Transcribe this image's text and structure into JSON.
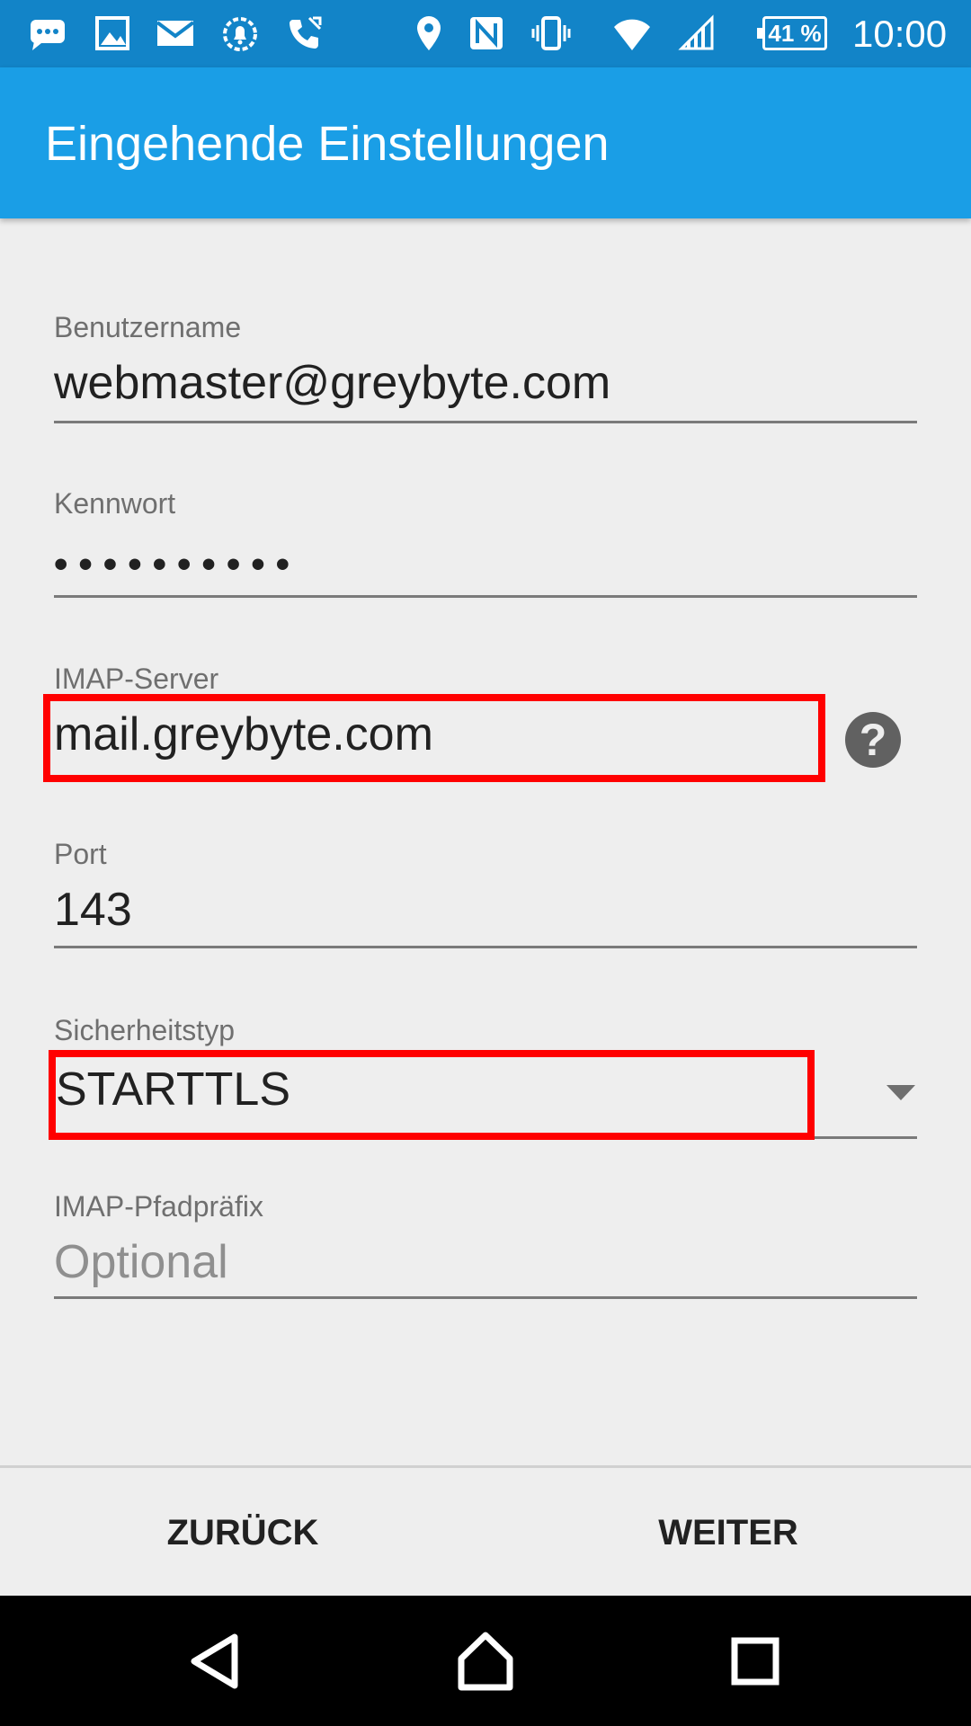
{
  "status_bar": {
    "battery": "41 %",
    "time": "10:00",
    "icons": [
      "messages-icon",
      "image-icon",
      "mail-icon",
      "alarm-icon",
      "phone-call-icon",
      "location-icon",
      "nfc-icon",
      "vibrate-icon",
      "wifi-icon",
      "signal-icon"
    ]
  },
  "app_bar": {
    "title": "Eingehende Einstellungen"
  },
  "form": {
    "username": {
      "label": "Benutzername",
      "value": "webmaster@greybyte.com"
    },
    "password": {
      "label": "Kennwort",
      "value": "••••••••••"
    },
    "imap_server": {
      "label": "IMAP-Server",
      "value": "mail.greybyte.com",
      "help": "?"
    },
    "port": {
      "label": "Port",
      "value": "143"
    },
    "security_type": {
      "label": "Sicherheitstyp",
      "value": "STARTTLS"
    },
    "imap_path_prefix": {
      "label": "IMAP-Pfadpräfix",
      "placeholder": "Optional"
    }
  },
  "buttons": {
    "back": "ZURÜCK",
    "next": "WEITER"
  },
  "colors": {
    "status_bar": "#1284c8",
    "app_bar": "#1a9ee6",
    "highlight": "#ff0000",
    "background": "#eeeeee"
  }
}
